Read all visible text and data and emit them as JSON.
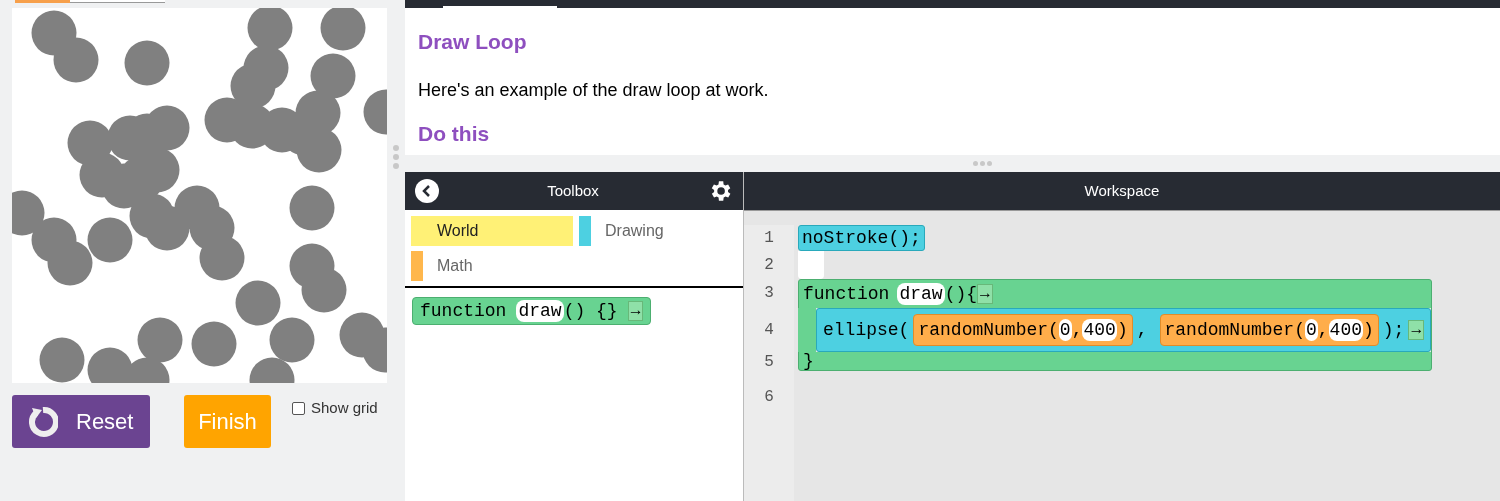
{
  "instructions": {
    "title": "Draw Loop",
    "text": "Here's an example of the draw loop at work.",
    "next_heading": "Do this"
  },
  "controls": {
    "reset": "Reset",
    "finish": "Finish",
    "show_grid": {
      "label": "Show grid",
      "checked": false
    }
  },
  "toolbox": {
    "title": "Toolbox",
    "categories": [
      {
        "label": "World",
        "color": "#fff176",
        "selected": true
      },
      {
        "label": "Drawing",
        "color": "#4dd0e1",
        "selected": false
      },
      {
        "label": "Math",
        "color": "#ffb74d",
        "selected": false
      }
    ],
    "blocks": [
      {
        "keyword": "function",
        "name": "draw",
        "suffix": "() {}",
        "arrow": "→"
      }
    ]
  },
  "workspace": {
    "title": "Workspace",
    "line_numbers": [
      "1",
      "2",
      "3",
      "4",
      "5",
      "6"
    ],
    "statement": {
      "text": "noStroke();"
    },
    "function": {
      "keyword": "function",
      "name": "draw",
      "suffix": "(){",
      "arrow": "→",
      "close": "}",
      "body": {
        "name": "ellipse(",
        "args": [
          {
            "name": "randomNumber(",
            "params": [
              "0",
              "400"
            ],
            "separator": ",",
            "close": ")"
          },
          {
            "name": "randomNumber(",
            "params": [
              "0",
              "400"
            ],
            "separator": ",",
            "close": ")"
          }
        ],
        "separator": ",",
        "end": ");",
        "arrow": "→"
      }
    }
  }
}
